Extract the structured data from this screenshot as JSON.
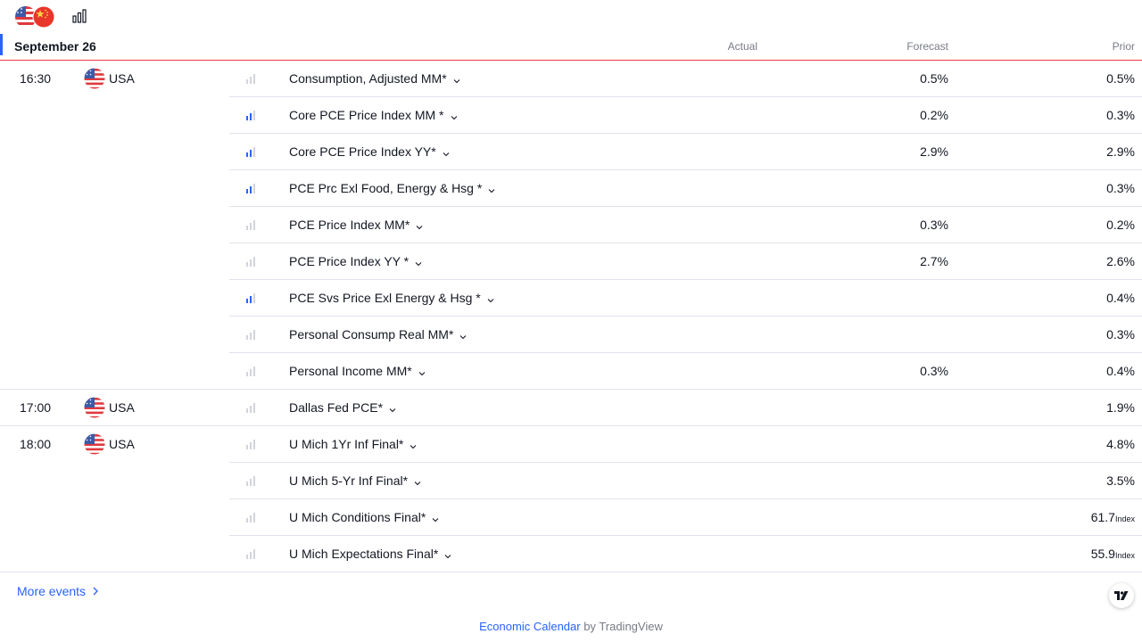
{
  "toolbar": {
    "flags_icon": "us-cn-flags-icon",
    "importance_icon": "importance-bars-icon"
  },
  "day": {
    "date": "September 26",
    "columns": {
      "actual": "Actual",
      "forecast": "Forecast",
      "prior": "Prior"
    }
  },
  "events": [
    {
      "time": "16:30",
      "country": "USA",
      "importance": "low",
      "title": "Consumption, Adjusted MM*",
      "forecast": "0.5%",
      "prior": "0.5%",
      "prior_unit": ""
    },
    {
      "time": "",
      "country": "",
      "importance": "medium",
      "title": "Core PCE Price Index MM *",
      "forecast": "0.2%",
      "prior": "0.3%",
      "prior_unit": ""
    },
    {
      "time": "",
      "country": "",
      "importance": "medium",
      "title": "Core PCE Price Index YY*",
      "forecast": "2.9%",
      "prior": "2.9%",
      "prior_unit": ""
    },
    {
      "time": "",
      "country": "",
      "importance": "medium",
      "title": "PCE Prc Exl Food, Energy & Hsg *",
      "forecast": "",
      "prior": "0.3%",
      "prior_unit": ""
    },
    {
      "time": "",
      "country": "",
      "importance": "low",
      "title": "PCE Price Index MM*",
      "forecast": "0.3%",
      "prior": "0.2%",
      "prior_unit": ""
    },
    {
      "time": "",
      "country": "",
      "importance": "low",
      "title": "PCE Price Index YY *",
      "forecast": "2.7%",
      "prior": "2.6%",
      "prior_unit": ""
    },
    {
      "time": "",
      "country": "",
      "importance": "medium",
      "title": "PCE Svs Price Exl Energy & Hsg *",
      "forecast": "",
      "prior": "0.4%",
      "prior_unit": ""
    },
    {
      "time": "",
      "country": "",
      "importance": "low",
      "title": "Personal Consump Real MM*",
      "forecast": "",
      "prior": "0.3%",
      "prior_unit": ""
    },
    {
      "time": "",
      "country": "",
      "importance": "low",
      "title": "Personal Income MM*",
      "forecast": "0.3%",
      "prior": "0.4%",
      "prior_unit": ""
    },
    {
      "time": "17:00",
      "country": "USA",
      "importance": "low",
      "title": "Dallas Fed PCE*",
      "forecast": "",
      "prior": "1.9%",
      "prior_unit": ""
    },
    {
      "time": "18:00",
      "country": "USA",
      "importance": "low",
      "title": "U Mich 1Yr Inf Final*",
      "forecast": "",
      "prior": "4.8%",
      "prior_unit": ""
    },
    {
      "time": "",
      "country": "",
      "importance": "low",
      "title": "U Mich 5-Yr Inf Final*",
      "forecast": "",
      "prior": "3.5%",
      "prior_unit": ""
    },
    {
      "time": "",
      "country": "",
      "importance": "low",
      "title": "U Mich Conditions Final*",
      "forecast": "",
      "prior": "61.7",
      "prior_unit": "Index"
    },
    {
      "time": "",
      "country": "",
      "importance": "low",
      "title": "U Mich Expectations Final*",
      "forecast": "",
      "prior": "55.9",
      "prior_unit": "Index"
    }
  ],
  "more_events": "More events",
  "footer": {
    "link": "Economic Calendar",
    "suffix": " by TradingView"
  },
  "colors": {
    "accent": "#2962ff",
    "divider_today": "#f23645",
    "separator": "#e0e3eb",
    "muted": "#787b86"
  }
}
